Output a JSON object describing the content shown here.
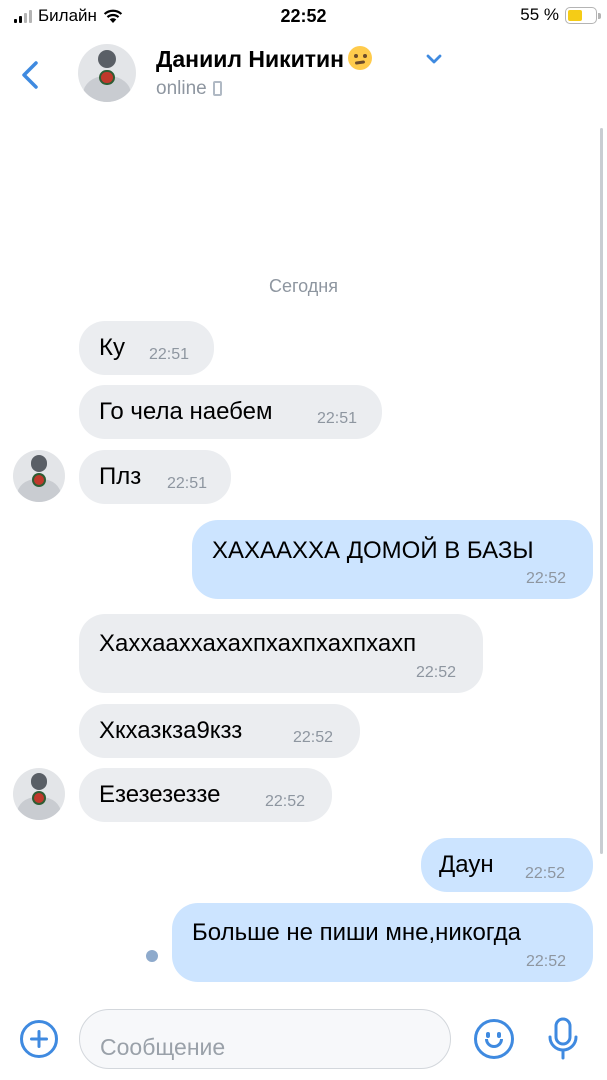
{
  "status_bar": {
    "carrier": "Билайн",
    "time": "22:52",
    "battery_text": "55 %",
    "battery_level": 0.55,
    "battery_color": "#f5cc16"
  },
  "header": {
    "contact_name": "Даниил Никитин",
    "name_emoji_icon": "woozy-face-icon",
    "status": "online",
    "status_icon": "phone-icon",
    "back_icon": "chevron-left-icon",
    "menu_icon": "chevron-down-icon"
  },
  "chat": {
    "date_label": "Сегодня",
    "messages": [
      {
        "direction": "in",
        "text": "Ку",
        "time": "22:51"
      },
      {
        "direction": "in",
        "text": "Го чела наебем",
        "time": "22:51"
      },
      {
        "direction": "in",
        "text": "Плз",
        "time": "22:51"
      },
      {
        "direction": "out",
        "text": "ХАХААХХА ДОМОЙ В БАЗЫ",
        "time": "22:52"
      },
      {
        "direction": "in",
        "text": "Хаххааххахахпхахпхахпхахп",
        "time": "22:52"
      },
      {
        "direction": "in",
        "text": "Хкхазкза9кзз",
        "time": "22:52"
      },
      {
        "direction": "in",
        "text": "Езезезеззе",
        "time": "22:52"
      },
      {
        "direction": "out",
        "text": "Даун",
        "time": "22:52"
      },
      {
        "direction": "out",
        "text": "Больше не пиши мне,никогда",
        "time": "22:52",
        "unread": true
      }
    ]
  },
  "composer": {
    "placeholder": "Сообщение",
    "attach_icon": "plus-circle-icon",
    "emoji_icon": "smile-icon",
    "voice_icon": "microphone-icon"
  },
  "colors": {
    "accent": "#3f8ae0",
    "incoming_bubble": "#ebedf0",
    "outgoing_bubble": "#cce4ff",
    "secondary_text": "#8e96a0"
  }
}
